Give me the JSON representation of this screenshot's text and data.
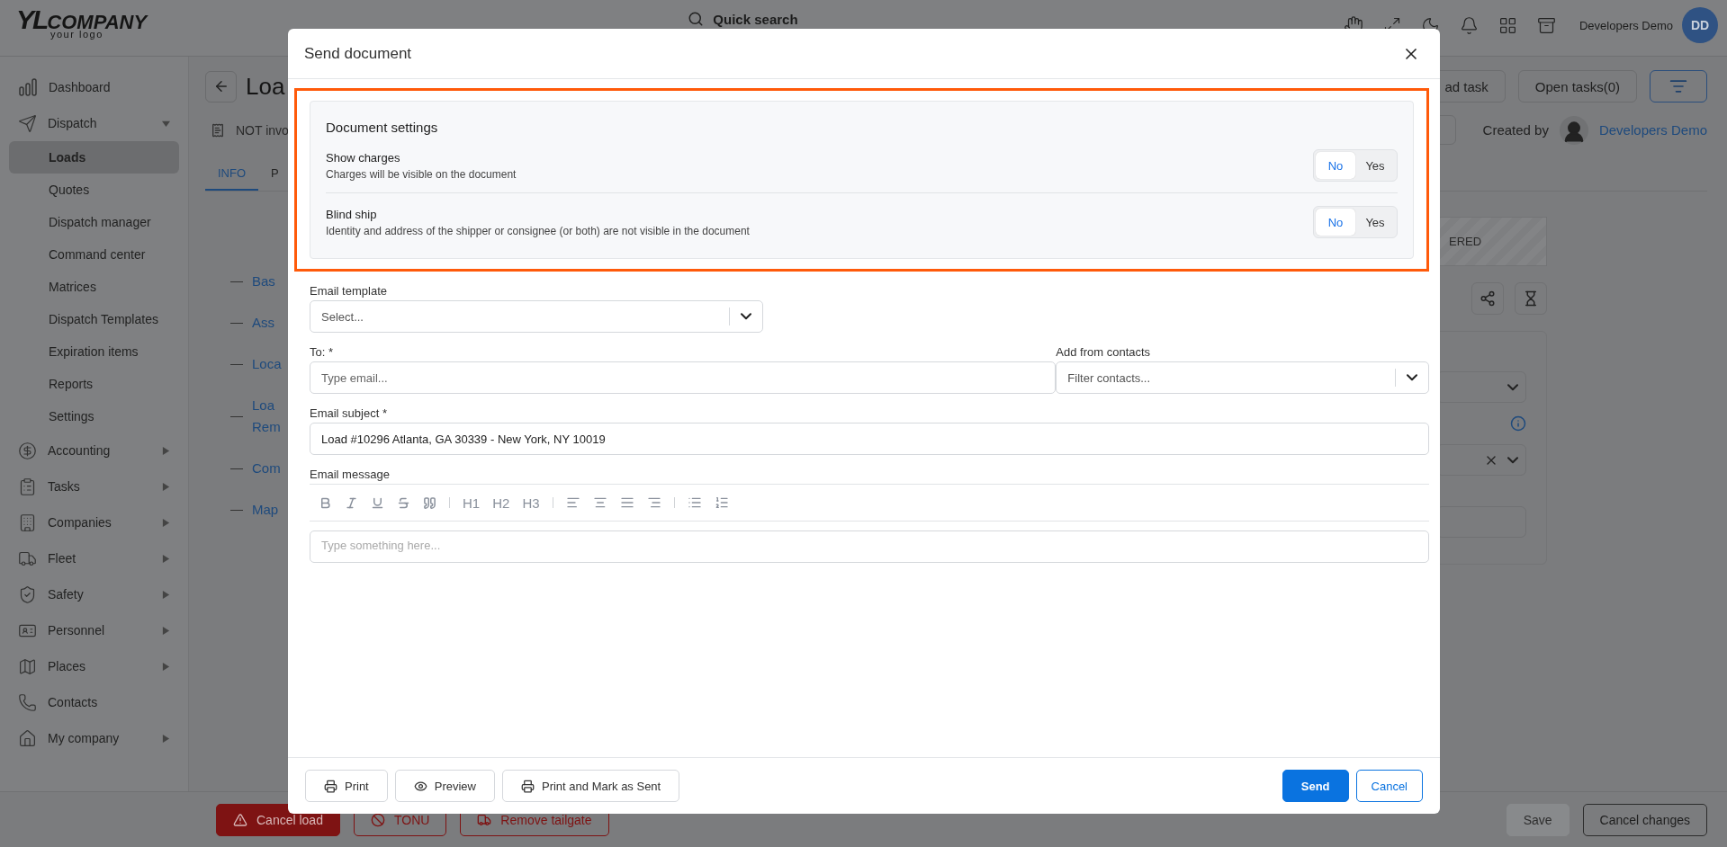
{
  "header": {
    "logo": {
      "mark": "YL",
      "name": "COMPANY",
      "tagline": "your logo"
    },
    "search": {
      "placeholder": "Quick search"
    },
    "user": {
      "name": "Developers Demo",
      "initials": "DD"
    }
  },
  "sidebar": {
    "items": [
      {
        "label": "Dashboard",
        "kind": "link"
      },
      {
        "label": "Dispatch",
        "kind": "group",
        "expanded": true,
        "children": [
          {
            "label": "Loads",
            "selected": true
          },
          {
            "label": "Quotes",
            "selected": false
          },
          {
            "label": "Dispatch manager",
            "selected": false
          },
          {
            "label": "Command center",
            "selected": false
          },
          {
            "label": "Matrices",
            "selected": false
          },
          {
            "label": "Dispatch Templates",
            "selected": false
          },
          {
            "label": "Expiration items",
            "selected": false
          },
          {
            "label": "Reports",
            "selected": false
          },
          {
            "label": "Settings",
            "selected": false
          }
        ]
      },
      {
        "label": "Accounting",
        "kind": "group",
        "expanded": false
      },
      {
        "label": "Tasks",
        "kind": "group",
        "expanded": false
      },
      {
        "label": "Companies",
        "kind": "group",
        "expanded": false
      },
      {
        "label": "Fleet",
        "kind": "group",
        "expanded": false
      },
      {
        "label": "Safety",
        "kind": "group",
        "expanded": false
      },
      {
        "label": "Personnel",
        "kind": "group",
        "expanded": false
      },
      {
        "label": "Places",
        "kind": "group",
        "expanded": false
      },
      {
        "label": "Contacts",
        "kind": "link"
      },
      {
        "label": "My company",
        "kind": "group",
        "expanded": false
      }
    ]
  },
  "load_page": {
    "title": "Loa",
    "status": "NOT invo",
    "tabs": [
      {
        "label": "INFO",
        "selected": true
      },
      {
        "label": "P",
        "selected": false
      }
    ],
    "actions": [
      "ad task",
      "Open tasks(0)"
    ],
    "created_by_label": "Created by",
    "created_by": "Developers Demo",
    "sections": [
      "Bas",
      "Ass",
      "Loca",
      "Loa Rem",
      "Com",
      "Map"
    ],
    "status_badge": "ERED",
    "left_actions": [
      {
        "label": "Cancel load",
        "kind": "danger"
      },
      {
        "label": "TONU",
        "kind": "danger-outline"
      },
      {
        "label": "Remove tailgate",
        "kind": "danger-outline"
      }
    ],
    "right_actions": [
      {
        "label": "Save",
        "kind": "disabled"
      },
      {
        "label": "Cancel changes",
        "kind": "outline"
      }
    ]
  },
  "modal": {
    "title": "Send document",
    "settings": {
      "title": "Document settings",
      "items": [
        {
          "label": "Show charges",
          "description": "Charges will be visible on the document",
          "options": [
            {
              "label": "No",
              "selected": true
            },
            {
              "label": "Yes",
              "selected": false
            }
          ]
        },
        {
          "label": "Blind ship",
          "description": "Identity and address of the shipper or consignee (or both) are not visible in the document",
          "options": [
            {
              "label": "No",
              "selected": true
            },
            {
              "label": "Yes",
              "selected": false
            }
          ]
        }
      ]
    },
    "form": {
      "template": {
        "label": "Email template",
        "placeholder": "Select..."
      },
      "to": {
        "label": "To: *",
        "placeholder": "Type email..."
      },
      "contacts": {
        "label": "Add from contacts",
        "placeholder": "Filter contacts..."
      },
      "subject": {
        "label": "Email subject *",
        "value": "Load #10296 Atlanta, GA 30339 - New York, NY 10019"
      },
      "message": {
        "label": "Email message",
        "headings": [
          "H1",
          "H2",
          "H3"
        ],
        "placeholder": "Type something here..."
      }
    },
    "footer": {
      "left": [
        "Print",
        "Preview",
        "Print and Mark as Sent"
      ],
      "send": "Send",
      "cancel": "Cancel"
    }
  }
}
